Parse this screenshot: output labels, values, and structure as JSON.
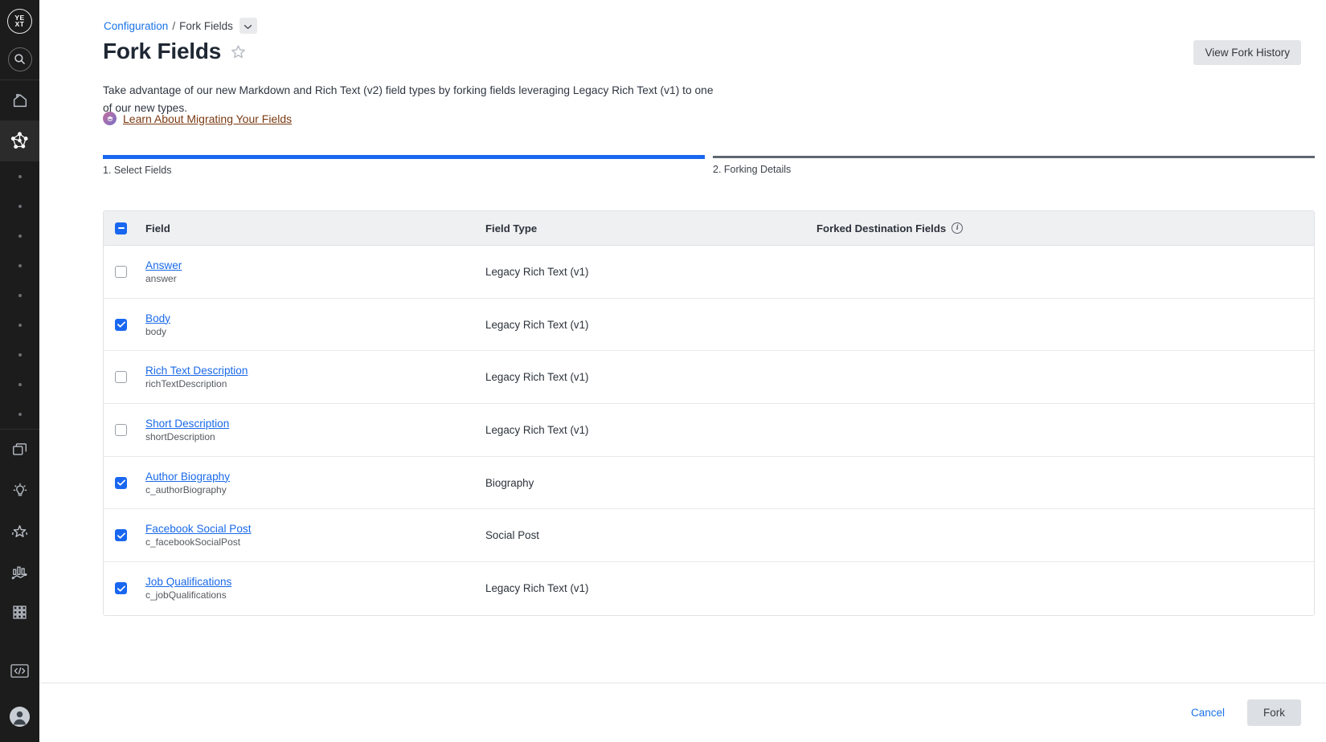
{
  "sidebar": {
    "logo_text": "YEXT",
    "items": [
      {
        "name": "search",
        "icon": "search-icon"
      },
      {
        "name": "home",
        "icon": "home-icon"
      },
      {
        "name": "knowledge-graph",
        "icon": "knowledge-graph-icon",
        "active": true
      },
      {
        "name": "pages",
        "icon": "pages-icon"
      },
      {
        "name": "listings",
        "icon": "lightbulb-icon"
      },
      {
        "name": "reviews",
        "icon": "sparkle-star-icon"
      },
      {
        "name": "analytics",
        "icon": "analytics-chart-icon"
      },
      {
        "name": "apps",
        "icon": "grid-apps-icon"
      },
      {
        "name": "developer",
        "icon": "code-icon"
      },
      {
        "name": "account",
        "icon": "user-avatar-icon"
      }
    ],
    "dot_count": 9
  },
  "breadcrumb": {
    "root": "Configuration",
    "separator": "/",
    "current": "Fork Fields"
  },
  "header": {
    "title": "Fork Fields",
    "subtitle": "Take advantage of our new Markdown and Rich Text (v2) field types by forking fields leveraging Legacy Rich Text (v1) to one of our new types.",
    "learn_link": "Learn About Migrating Your Fields",
    "view_history_label": "View Fork History"
  },
  "stepper": {
    "steps": [
      {
        "label": "1. Select Fields",
        "state": "active"
      },
      {
        "label": "2. Forking Details",
        "state": "inactive"
      }
    ]
  },
  "table": {
    "header_checkbox_state": "indeterminate",
    "columns": {
      "field": "Field",
      "field_type": "Field Type",
      "forked_destination": "Forked Destination Fields"
    },
    "rows": [
      {
        "checked": false,
        "name": "Answer",
        "api": "answer",
        "type": "Legacy Rich Text (v1)",
        "dest": ""
      },
      {
        "checked": true,
        "name": "Body",
        "api": "body",
        "type": "Legacy Rich Text (v1)",
        "dest": ""
      },
      {
        "checked": false,
        "name": "Rich Text Description",
        "api": "richTextDescription",
        "type": "Legacy Rich Text (v1)",
        "dest": ""
      },
      {
        "checked": false,
        "name": "Short Description",
        "api": "shortDescription",
        "type": "Legacy Rich Text (v1)",
        "dest": ""
      },
      {
        "checked": true,
        "name": "Author Biography",
        "api": "c_authorBiography",
        "type": "Biography",
        "dest": ""
      },
      {
        "checked": true,
        "name": "Facebook Social Post",
        "api": "c_facebookSocialPost",
        "type": "Social Post",
        "dest": ""
      },
      {
        "checked": true,
        "name": "Job Qualifications",
        "api": "c_jobQualifications",
        "type": "Legacy Rich Text (v1)",
        "dest": ""
      }
    ]
  },
  "footer": {
    "cancel_label": "Cancel",
    "fork_label": "Fork"
  },
  "colors": {
    "accent_blue": "#1967f0",
    "link_blue": "#1a73e8",
    "rail_bg": "#1c1c1c",
    "header_bg": "#eff0f2",
    "link_brown": "#7a3a12"
  }
}
